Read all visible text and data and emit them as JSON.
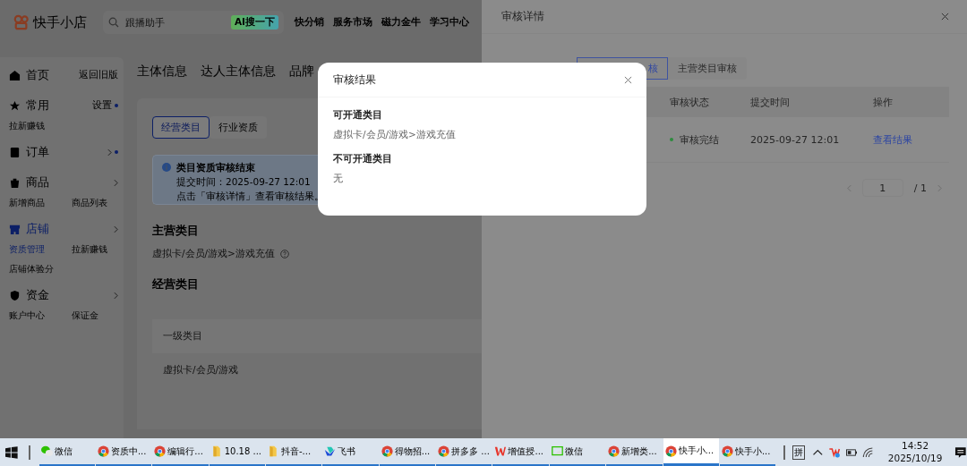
{
  "header": {
    "logo": "快手小店",
    "search": {
      "placeholder": "跟播助手"
    },
    "ai_button": "AI搜一下",
    "nav": [
      "快分销",
      "服务市场",
      "磁力金牛",
      "学习中心"
    ]
  },
  "sidebar": {
    "items": [
      {
        "label": "首页",
        "extra": "返回旧版",
        "selected": false
      },
      {
        "label": "常用",
        "extra": "设置",
        "dot": true,
        "selected": false,
        "links": [
          {
            "label": "拉新赚钱",
            "selected": false
          }
        ]
      },
      {
        "label": "订单",
        "dot": true,
        "arrow": true,
        "selected": false
      },
      {
        "label": "商品",
        "arrow": true,
        "selected": false,
        "links": [
          {
            "label": "新增商品",
            "selected": false
          },
          {
            "label": "商品列表",
            "selected": false
          }
        ]
      },
      {
        "label": "店铺",
        "arrow": true,
        "selected": true,
        "links": [
          {
            "label": "资质管理",
            "selected": true
          },
          {
            "label": "拉新赚钱",
            "selected": false
          },
          {
            "label": "店铺体验分",
            "selected": false
          }
        ]
      },
      {
        "label": "资金",
        "arrow": true,
        "selected": false,
        "links": [
          {
            "label": "账户中心",
            "selected": false
          },
          {
            "label": "保证金",
            "selected": false
          }
        ]
      }
    ]
  },
  "page_tabs": [
    "主体信息",
    "达人主体信息",
    "品牌"
  ],
  "content": {
    "tabs": [
      {
        "label": "经营类目",
        "selected": true
      },
      {
        "label": "行业资质",
        "selected": false
      }
    ],
    "notice": {
      "title": "类目资质审核结束",
      "lines": [
        "提交时间：2025-09-27 12:01",
        "点击「审核详情」查看审核结果。"
      ]
    },
    "main_category": {
      "heading": "主营类目",
      "value": "虚拟卡/会员/游戏>游戏充值"
    },
    "business_category": {
      "heading": "经营类目",
      "table": {
        "columns": [
          "一级类目"
        ],
        "rows": [
          [
            "虚拟卡/会员/游戏"
          ]
        ]
      }
    }
  },
  "drawer": {
    "title": "审核详情",
    "tabs": [
      {
        "label": "核",
        "selected": true
      },
      {
        "label": "主营类目审核",
        "selected": false
      }
    ],
    "table": {
      "columns": [
        "审核状态",
        "提交时间",
        "操作"
      ],
      "rows": [
        {
          "status": "审核完结",
          "color": "#2e8b3e",
          "time": "2025-09-27 12:01",
          "action": "查看结果"
        }
      ]
    },
    "pagination": {
      "page": "1",
      "total": "/ 1"
    }
  },
  "modal": {
    "title": "审核结果",
    "sections": [
      {
        "heading": "可开通类目",
        "value": "虚拟卡/会员/游戏>游戏充值"
      },
      {
        "heading": "不可开通类目",
        "value": "无"
      }
    ]
  },
  "taskbar": {
    "items": [
      {
        "label": "微信",
        "kind": "wechat",
        "selected": false
      },
      {
        "label": "资质中...",
        "kind": "chrome",
        "selected": false
      },
      {
        "label": "编辑行...",
        "kind": "chrome",
        "selected": false
      },
      {
        "label": "10.18 ...",
        "kind": "folder",
        "selected": false
      },
      {
        "label": "抖音-...",
        "kind": "folder",
        "selected": false
      },
      {
        "label": "飞书",
        "kind": "feishu",
        "selected": false
      },
      {
        "label": "得物招...",
        "kind": "chrome",
        "selected": false
      },
      {
        "label": "拼多多 ...",
        "kind": "chrome",
        "selected": false
      },
      {
        "label": "增值授...",
        "kind": "wps",
        "selected": false
      },
      {
        "label": "微信",
        "kind": "wework",
        "selected": false
      },
      {
        "label": "新增类...",
        "kind": "chrome",
        "selected": false
      },
      {
        "label": "快手小...",
        "kind": "chrome",
        "selected": true
      },
      {
        "label": "快手小...",
        "kind": "chrome",
        "selected": false
      }
    ],
    "tray": {
      "ime": "拼",
      "time": "14:52",
      "date": "2025/10/19"
    }
  }
}
